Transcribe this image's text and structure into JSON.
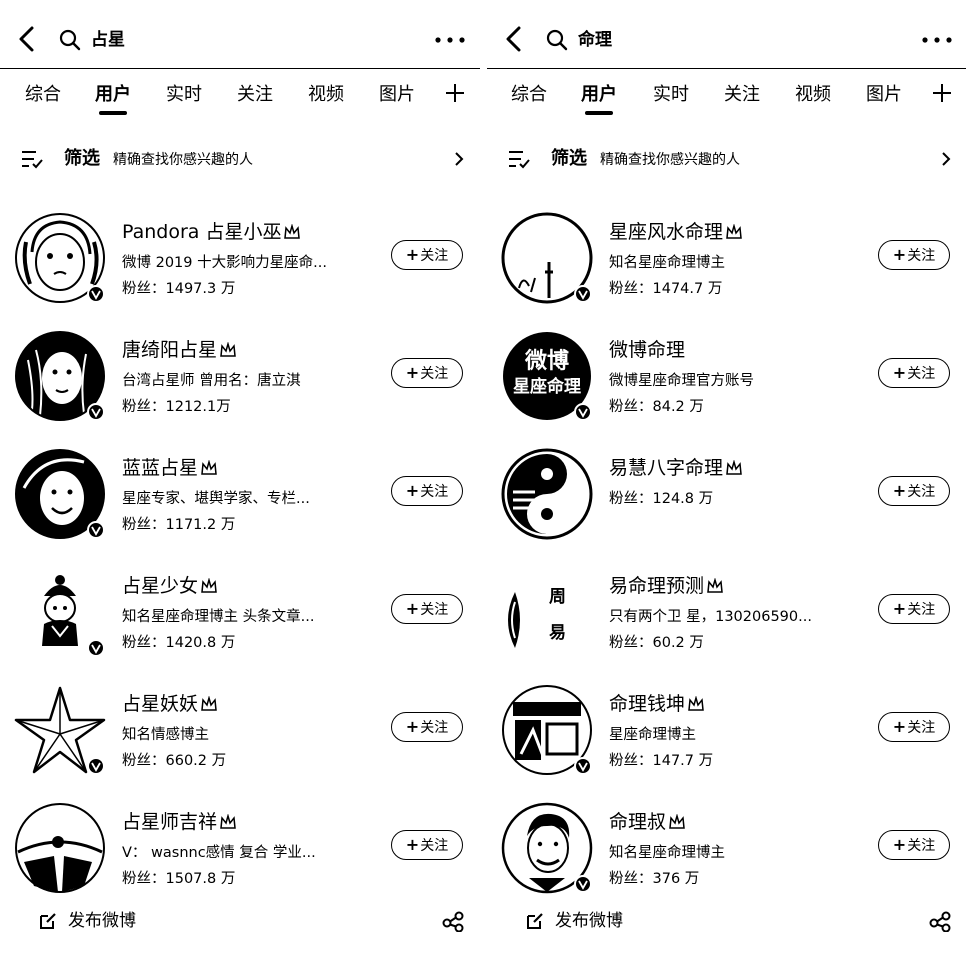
{
  "colors": {
    "foreground": "#000000",
    "background": "#ffffff"
  },
  "panels": [
    {
      "search": {
        "query": "占星"
      },
      "tabs": [
        "综合",
        "用户",
        "实时",
        "关注",
        "视频",
        "图片"
      ],
      "active_tab": "用户",
      "filter": {
        "label": "筛选",
        "desc": "精确查找你感兴趣的人"
      },
      "users": [
        {
          "name": "Pandora 占星小巫",
          "desc": "微博 2019 十大影响力星座命...",
          "fans": "粉丝：1497.3 万",
          "follow": "关注",
          "verified": true
        },
        {
          "name": "唐绮阳占星",
          "desc": "台湾占星师 曾用名：唐立淇",
          "fans": "粉丝：1212.1万",
          "follow": "关注",
          "verified": true
        },
        {
          "name": "蓝蓝占星",
          "desc": "星座专家、堪舆学家、专栏...",
          "fans": "粉丝：1171.2 万",
          "follow": "关注",
          "verified": true
        },
        {
          "name": "占星少女",
          "desc": "知名星座命理博主 头条文章...",
          "fans": "粉丝：1420.8 万",
          "follow": "关注",
          "verified": true
        },
        {
          "name": "占星妖妖",
          "desc": "知名情感博主",
          "fans": "粉丝：660.2 万",
          "follow": "关注",
          "verified": true
        },
        {
          "name": "占星师吉祥",
          "desc": "V： wasnnc感情 复合 学业...",
          "fans": "粉丝：1507.8 万",
          "follow": "关注",
          "verified": false
        }
      ],
      "compose_label": "发布微博"
    },
    {
      "search": {
        "query": "命理"
      },
      "tabs": [
        "综合",
        "用户",
        "实时",
        "关注",
        "视频",
        "图片"
      ],
      "active_tab": "用户",
      "filter": {
        "label": "筛选",
        "desc": "精确查找你感兴趣的人"
      },
      "users": [
        {
          "name": "星座风水命理",
          "desc": "知名星座命理博主",
          "fans": "粉丝：1474.7 万",
          "follow": "关注",
          "verified": true
        },
        {
          "name": "微博命理",
          "desc": "微博星座命理官方账号",
          "fans": "粉丝：84.2 万",
          "follow": "关注",
          "verified": true
        },
        {
          "name": "易慧八字命理",
          "desc": "",
          "fans": "粉丝：124.8 万",
          "follow": "关注",
          "verified": false
        },
        {
          "name": "易命理预测",
          "desc": "只有两个卫 星，130206590...",
          "fans": "粉丝：60.2 万",
          "follow": "关注",
          "verified": false,
          "avatar_text": [
            "周",
            "易"
          ]
        },
        {
          "name": "命理钱坤",
          "desc": "星座命理博主",
          "fans": "粉丝：147.7 万",
          "follow": "关注",
          "verified": true
        },
        {
          "name": "命理叔",
          "desc": "知名星座命理博主",
          "fans": "粉丝：376 万",
          "follow": "关注",
          "verified": true
        }
      ],
      "compose_label": "发布微博"
    }
  ],
  "avatar_labels": {
    "weibo_mingli": [
      "微博",
      "星座命理"
    ]
  }
}
